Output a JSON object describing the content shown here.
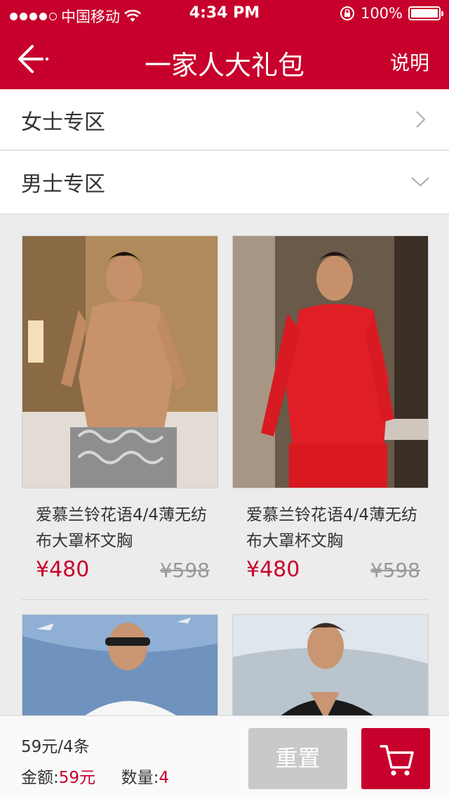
{
  "status_bar": {
    "carrier": "中国移动",
    "time": "4:34 PM",
    "battery": "100%"
  },
  "header": {
    "title": "一家人大礼包",
    "help_label": "说明"
  },
  "sections": [
    {
      "label": "女士专区",
      "state": "collapsed"
    },
    {
      "label": "男士专区",
      "state": "expanded"
    }
  ],
  "products": [
    {
      "name": "爱慕兰铃花语4/4薄无纺布大罩杯文胸",
      "price": "¥480",
      "original_price": "¥598"
    },
    {
      "name": "爱慕兰铃花语4/4薄无纺布大罩杯文胸",
      "price": "¥480",
      "original_price": "¥598"
    }
  ],
  "footer": {
    "summary": "59元/4条",
    "amount_label": "金额:",
    "amount_value": "59元",
    "count_label": "数量:",
    "count_value": "4",
    "reset_label": "重置"
  },
  "colors": {
    "accent": "#c7002c",
    "disabled": "#c9c9c9"
  }
}
